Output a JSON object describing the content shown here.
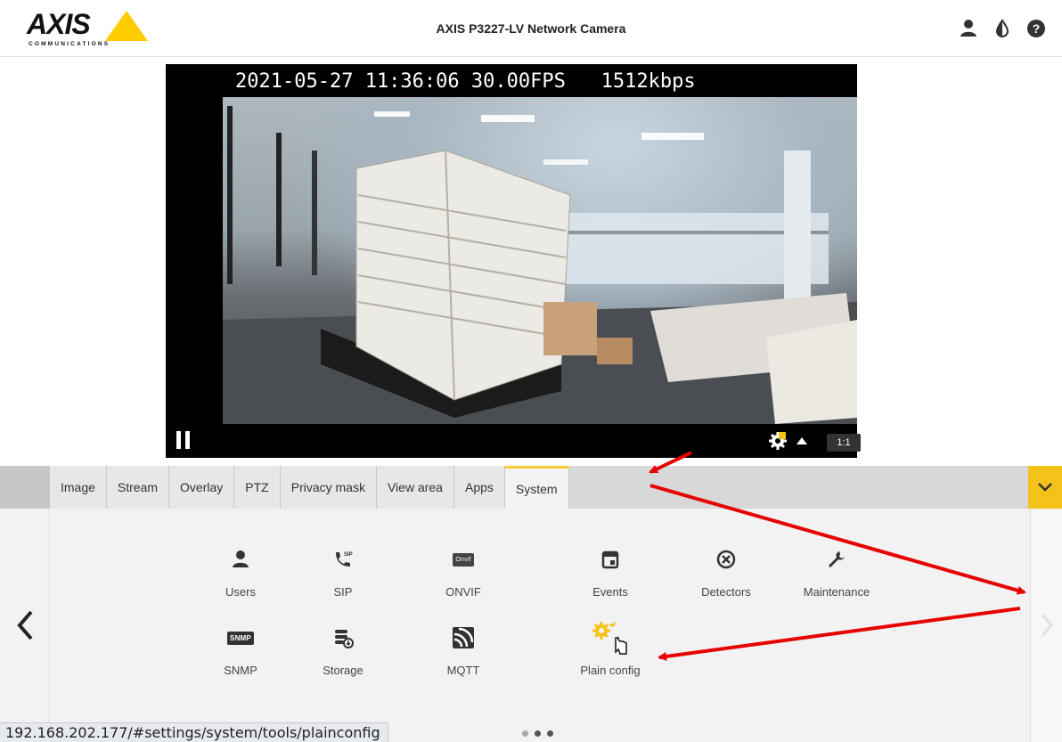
{
  "header": {
    "logo_text": "AXIS",
    "logo_sub": "COMMUNICATIONS",
    "title": "AXIS P3227-LV Network Camera",
    "icons": [
      "user-icon",
      "contrast-icon",
      "help-icon"
    ]
  },
  "video": {
    "overlay": "2021-05-27 11:36:06 30.00FPS   1512kbps",
    "zoom_label": "1:1"
  },
  "tabs": [
    {
      "label": "Image"
    },
    {
      "label": "Stream"
    },
    {
      "label": "Overlay"
    },
    {
      "label": "PTZ"
    },
    {
      "label": "Privacy mask"
    },
    {
      "label": "View area"
    },
    {
      "label": "Apps"
    },
    {
      "label": "System"
    }
  ],
  "active_tab": "System",
  "system_items": [
    {
      "label": "Users",
      "icon": "user-icon"
    },
    {
      "label": "SIP",
      "icon": "sip-phone-icon"
    },
    {
      "label": "ONVIF",
      "icon": "onvif-icon",
      "badge": "Onvif"
    },
    {
      "label": "Events",
      "icon": "calendar-icon"
    },
    {
      "label": "Detectors",
      "icon": "detector-icon"
    },
    {
      "label": "Maintenance",
      "icon": "wrench-icon"
    },
    {
      "label": "SNMP",
      "icon": "snmp-icon",
      "badge": "SNMP"
    },
    {
      "label": "Storage",
      "icon": "storage-icon"
    },
    {
      "label": "MQTT",
      "icon": "mqtt-icon"
    },
    {
      "label": "Plain config",
      "icon": "plain-config-icon"
    }
  ],
  "status_url": "192.168.202.177/#settings/system/tools/plainconfig",
  "colors": {
    "accent": "#f5c21a",
    "annotation": "#e60000"
  }
}
